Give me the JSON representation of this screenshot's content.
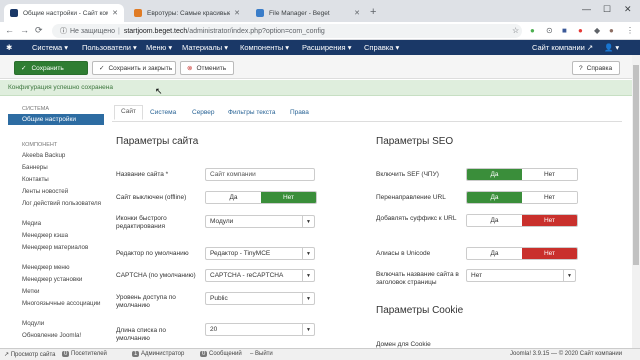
{
  "browser": {
    "tabs": [
      {
        "title": "Общие настройки - Сайт компании",
        "favicon_color": "#1a3867"
      },
      {
        "title": "Евротуры: Самые красивые места!",
        "favicon_color": "#e07b24"
      },
      {
        "title": "File Manager - Beget",
        "favicon_color": "#3a7dc9"
      }
    ],
    "new_tab": "+",
    "back": "←",
    "forward": "→",
    "reload": "⟳",
    "not_secure": "Не защищено",
    "url_host": "startjoom.beget.tech",
    "url_path": "/administrator/index.php?option=com_config",
    "window": {
      "min": "—",
      "max": "☐",
      "close": "✕"
    }
  },
  "joomla_nav": {
    "items": [
      "Система ▾",
      "Пользователи ▾",
      "Меню ▾",
      "Материалы ▾",
      "Компоненты ▾",
      "Расширения ▾",
      "Справка ▾"
    ],
    "site": "Сайт компании ↗",
    "user": "👤 ▾"
  },
  "toolbar": {
    "save": "Сохранить",
    "save_close": "Сохранить и закрыть",
    "cancel": "Отменить",
    "help": "Справка"
  },
  "alert": "Конфигурация успешно сохранена",
  "sidebar": {
    "system_header": "СИСТЕМА",
    "active": "Общие настройки",
    "component_header": "КОМПОНЕНТ",
    "links": [
      "Akeeba Backup",
      "Баннеры",
      "Контакты",
      "Ленты новостей",
      "Лог действий пользователя",
      "Медиа",
      "Менеджер кэша",
      "Менеджер материалов",
      "Менеджер меню",
      "Менеджер установки",
      "Метки",
      "Многоязычные ассоциации",
      "Модули",
      "Обновление Joomla!"
    ]
  },
  "tabs": [
    "Сайт",
    "Система",
    "Сервер",
    "Фильтры текста",
    "Права"
  ],
  "site_params": {
    "title": "Параметры сайта",
    "site_name_label": "Название сайта *",
    "site_name_value": "Сайт компании",
    "offline_label": "Сайт выключен (offline)",
    "offline_yes": "Да",
    "offline_no": "Нет",
    "icons_label": "Иконки быстрого редактирования",
    "icons_value": "Модули",
    "editor_label": "Редактор по умолчанию",
    "editor_value": "Редактор - TinyMCE",
    "captcha_label": "CAPTCHA (по умолчанию)",
    "captcha_value": "CAPTCHA - reCAPTCHA",
    "access_label": "Уровень доступа по умолчанию",
    "access_value": "Public",
    "list_label": "Длина списка по умолчанию",
    "list_value": "20"
  },
  "seo_params": {
    "title": "Параметры SEO",
    "sef_label": "Включить SEF (ЧПУ)",
    "rewrite_label": "Перенаправление URL",
    "suffix_label": "Добавлять суффикс к URL",
    "unicode_label": "Алиасы в Unicode",
    "yes": "Да",
    "no": "Нет",
    "sitename_label": "Включать название сайта в заголовок страницы",
    "sitename_value": "Нет"
  },
  "cookie_params": {
    "title": "Параметры Cookie",
    "domain_label": "Домен для Cookie"
  },
  "status": {
    "preview": "Просмотр сайта",
    "visitors_count": "0",
    "visitors": "Посетителей",
    "admins_count": "1",
    "admins": "Администратор",
    "messages_count": "0",
    "messages": "Сообщений",
    "logout": "Выйти",
    "version": "Joomla! 3.9.15 — © 2020 Сайт компании"
  }
}
